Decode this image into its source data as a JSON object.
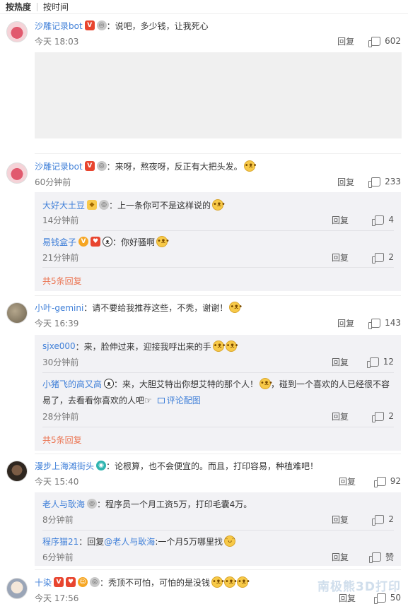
{
  "sort": {
    "hot": "按热度",
    "time": "按时间"
  },
  "actions": {
    "reply": "回复"
  },
  "comments": [
    {
      "user": "沙雕记录bot",
      "text": "：说吧，多少钱，让我死心",
      "time": "今天 18:03",
      "likes": "602"
    },
    {
      "user": "沙雕记录bot",
      "text": "：来呀，熬夜呀，反正有大把头发。",
      "time": "60分钟前",
      "likes": "233",
      "replies": [
        {
          "user": "大好大土豆",
          "text": "：上一条你可不是这样说的",
          "time": "14分钟前",
          "likes": "4"
        },
        {
          "user": "易钱盒子",
          "text": "：你好骚啊",
          "time": "21分钟前",
          "likes": "2"
        }
      ],
      "more": "共5条回复"
    },
    {
      "user": "小叶-gemini",
      "text": "：请不要给我推荐这些，不秃，谢谢！",
      "time": "今天 16:39",
      "likes": "143",
      "replies": [
        {
          "user": "sjxe000",
          "text": "：来，脸伸过来，迎接我呼出来的手",
          "time": "30分钟前",
          "likes": "12"
        },
        {
          "user": "小猪飞的高又高",
          "text": "：来，大胆艾特出你想艾特的那个人！",
          "text2": "，碰到一个喜欢的人已经很不容",
          "text3": "易了，去看看你喜欢的人吧☞",
          "pic_link": "评论配图",
          "time": "28分钟前",
          "likes": "2"
        }
      ],
      "more": "共5条回复"
    },
    {
      "user": "漫步上海滩街头",
      "text": "：论根算，也不会便宜的。而且，打印容易，种植难吧！",
      "time": "今天 15:40",
      "likes": "92",
      "replies": [
        {
          "user": "老人与耿海",
          "text": "：程序员一个月工资5万，打印毛囊4万。",
          "time": "8分钟前",
          "likes": "2"
        },
        {
          "user": "程序猫21",
          "text": "：回复",
          "mention": "@老人与耿海",
          "text_after": ":一个月5万哪里找",
          "time": "6分钟前",
          "likes": "赞"
        }
      ]
    },
    {
      "user": "十染",
      "text": "：秃顶不可怕，可怕的是没钱",
      "time": "今天 17:56",
      "likes": "50"
    }
  ],
  "watermark": "南极熊3D打印",
  "icons": {
    "like": "thumb-up-icon",
    "emoji": "doge-emoji-icon",
    "badge": "member-badge-icon"
  }
}
